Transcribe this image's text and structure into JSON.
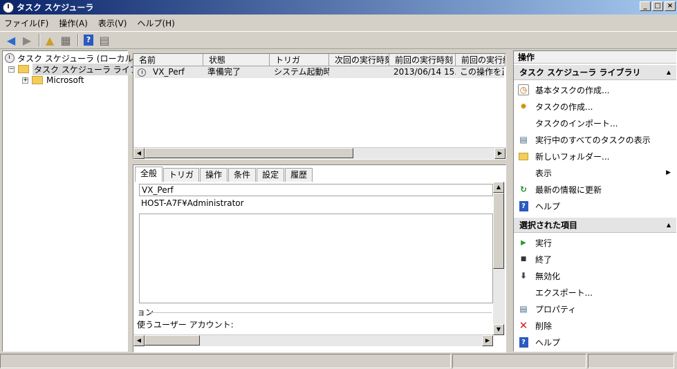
{
  "window": {
    "title": "タスク スケジューラ"
  },
  "menu": [
    "ファイル(F)",
    "操作(A)",
    "表示(V)",
    "ヘルプ(H)"
  ],
  "toolbar": {
    "icons": [
      "back-arrow-icon",
      "forward-arrow-icon",
      "up-folder-icon",
      "show-hide-tree-icon",
      "help-icon",
      "show-hide-action-pane-icon"
    ]
  },
  "tree": {
    "root": "タスク スケジューラ (ローカル)",
    "library": "タスク スケジューラ ライブラリ",
    "child": "Microsoft"
  },
  "tasklist": {
    "columns": [
      "名前",
      "状態",
      "トリガ",
      "次回の実行時刻",
      "前回の実行時刻",
      "前回の実行結"
    ],
    "rows": [
      {
        "name": "VX_Perf",
        "status": "準備完了",
        "trigger": "システム起動時",
        "next_run": "",
        "last_run": "2013/06/14 15...",
        "last_result": "この操作を正"
      }
    ]
  },
  "detail": {
    "tabs": [
      "全般",
      "トリガ",
      "操作",
      "条件",
      "設定",
      "履歴"
    ],
    "name_value": "VX_Perf",
    "author_value": "HOST-A7F¥Administrator",
    "options_group": "ョン",
    "user_account_label": "使うユーザー アカウント:"
  },
  "actions": {
    "pane_title": "操作",
    "section1": {
      "title": "タスク スケジューラ ライブラリ",
      "items": [
        "基本タスクの作成...",
        "タスクの作成...",
        "タスクのインポート...",
        "実行中のすべてのタスクの表示",
        "新しいフォルダー...",
        "表示",
        "最新の情報に更新",
        "ヘルプ"
      ]
    },
    "section2": {
      "title": "選択された項目",
      "items": [
        "実行",
        "終了",
        "無効化",
        "エクスポート...",
        "プロパティ",
        "削除",
        "ヘルプ"
      ]
    }
  }
}
